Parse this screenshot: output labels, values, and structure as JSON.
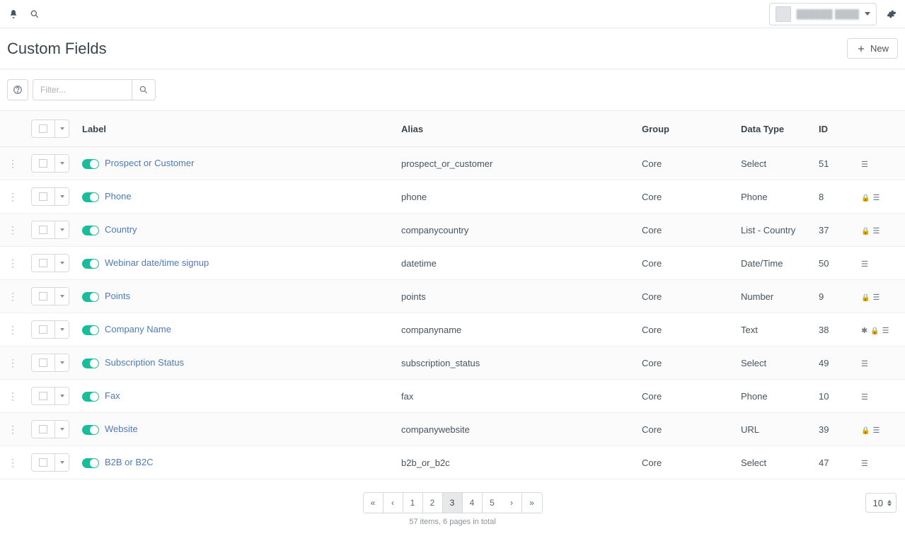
{
  "topbar": {
    "user_name": "██████ ████"
  },
  "page": {
    "title": "Custom Fields",
    "new_button": "New"
  },
  "toolbar": {
    "filter_placeholder": "Filter..."
  },
  "table": {
    "headers": {
      "label": "Label",
      "alias": "Alias",
      "group": "Group",
      "data_type": "Data Type",
      "id": "ID"
    },
    "rows": [
      {
        "label": "Prospect or Customer",
        "alias": "prospect_or_customer",
        "group": "Core",
        "data_type": "Select",
        "id": "51",
        "icons": [
          "list"
        ]
      },
      {
        "label": "Phone",
        "alias": "phone",
        "group": "Core",
        "data_type": "Phone",
        "id": "8",
        "icons": [
          "lock",
          "list"
        ]
      },
      {
        "label": "Country",
        "alias": "companycountry",
        "group": "Core",
        "data_type": "List - Country",
        "id": "37",
        "icons": [
          "lock",
          "list"
        ]
      },
      {
        "label": "Webinar date/time signup",
        "alias": "datetime",
        "group": "Core",
        "data_type": "Date/Time",
        "id": "50",
        "icons": [
          "list"
        ]
      },
      {
        "label": "Points",
        "alias": "points",
        "group": "Core",
        "data_type": "Number",
        "id": "9",
        "icons": [
          "lock",
          "list"
        ]
      },
      {
        "label": "Company Name",
        "alias": "companyname",
        "group": "Core",
        "data_type": "Text",
        "id": "38",
        "icons": [
          "star",
          "lock",
          "list"
        ]
      },
      {
        "label": "Subscription Status",
        "alias": "subscription_status",
        "group": "Core",
        "data_type": "Select",
        "id": "49",
        "icons": [
          "list"
        ]
      },
      {
        "label": "Fax",
        "alias": "fax",
        "group": "Core",
        "data_type": "Phone",
        "id": "10",
        "icons": [
          "list"
        ]
      },
      {
        "label": "Website",
        "alias": "companywebsite",
        "group": "Core",
        "data_type": "URL",
        "id": "39",
        "icons": [
          "lock",
          "list"
        ]
      },
      {
        "label": "B2B or B2C",
        "alias": "b2b_or_b2c",
        "group": "Core",
        "data_type": "Select",
        "id": "47",
        "icons": [
          "list"
        ]
      }
    ]
  },
  "pagination": {
    "pages": [
      "1",
      "2",
      "3",
      "4",
      "5"
    ],
    "current": "3",
    "page_size": "10",
    "summary": "57 items, 6 pages in total"
  }
}
